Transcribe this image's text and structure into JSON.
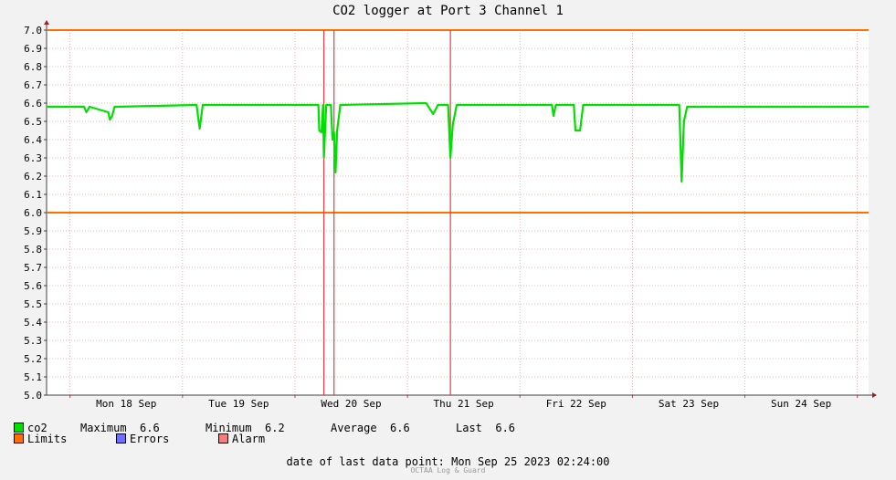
{
  "title": "CO2 logger at Port 3 Channel 1",
  "legend": {
    "co2": {
      "label": "co2",
      "color": "#00e000"
    },
    "maximum": {
      "label": "Maximum",
      "value": "6.6"
    },
    "minimum": {
      "label": "Minimum",
      "value": "6.2"
    },
    "average": {
      "label": "Average",
      "value": "6.6"
    },
    "last": {
      "label": "Last",
      "value": "6.6"
    },
    "limits": {
      "label": "Limits",
      "color": "#ff7000"
    },
    "errors": {
      "label": "Errors",
      "color": "#7070ff"
    },
    "alarm": {
      "label": "Alarm",
      "color": "#f08080"
    }
  },
  "footer": {
    "label": "date of last data point:",
    "value": "Mon Sep 25 2023 02:24:00"
  },
  "credit": "OCTAA Log & Guard",
  "chart_data": {
    "type": "line",
    "title": "CO2 logger at Port 3 Channel 1",
    "xlabel": "",
    "ylabel": "",
    "x_range": [
      "2023-09-17T19:00",
      "2023-09-25T02:24"
    ],
    "ylim": [
      5.0,
      7.0
    ],
    "yticks": [
      7.0,
      6.9,
      6.8,
      6.7,
      6.6,
      6.5,
      6.4,
      6.3,
      6.2,
      6.1,
      6.0,
      5.9,
      5.8,
      5.7,
      5.6,
      5.5,
      5.4,
      5.3,
      5.2,
      5.1,
      5.0
    ],
    "ytick_labels": [
      "7.0",
      "6.9",
      "6.8",
      "6.7",
      "6.6",
      "6.5",
      "6.4",
      "6.3",
      "6.2",
      "6.1",
      "6.0",
      "5.9",
      "5.8",
      "5.7",
      "5.6",
      "5.5",
      "5.4",
      "5.3",
      "5.2",
      "5.1",
      "5.0"
    ],
    "xticks": [
      {
        "label": "Mon 18 Sep",
        "date": "2023-09-18T12:00"
      },
      {
        "label": "Tue 19 Sep",
        "date": "2023-09-19T12:00"
      },
      {
        "label": "Wed 20 Sep",
        "date": "2023-09-20T12:00"
      },
      {
        "label": "Thu 21 Sep",
        "date": "2023-09-21T12:00"
      },
      {
        "label": "Fri 22 Sep",
        "date": "2023-09-22T12:00"
      },
      {
        "label": "Sat 23 Sep",
        "date": "2023-09-23T12:00"
      },
      {
        "label": "Sun 24 Sep",
        "date": "2023-09-24T12:00"
      }
    ],
    "day_boundaries": [
      "2023-09-18T00:00",
      "2023-09-19T00:00",
      "2023-09-20T00:00",
      "2023-09-21T00:00",
      "2023-09-22T00:00",
      "2023-09-23T00:00",
      "2023-09-24T00:00",
      "2023-09-25T00:00"
    ],
    "grid": true,
    "limits": [
      7.0,
      6.0
    ],
    "alarms": [
      "2023-09-20T06:10",
      "2023-09-20T08:20",
      "2023-09-21T09:10"
    ],
    "series": [
      {
        "name": "co2",
        "color": "#00e000",
        "points": [
          [
            "2023-09-17T19:00",
            6.58
          ],
          [
            "2023-09-18T03:00",
            6.58
          ],
          [
            "2023-09-18T03:30",
            6.55
          ],
          [
            "2023-09-18T04:10",
            6.58
          ],
          [
            "2023-09-18T08:10",
            6.55
          ],
          [
            "2023-09-18T08:30",
            6.51
          ],
          [
            "2023-09-18T09:00",
            6.53
          ],
          [
            "2023-09-18T09:30",
            6.58
          ],
          [
            "2023-09-19T03:00",
            6.59
          ],
          [
            "2023-09-19T03:40",
            6.46
          ],
          [
            "2023-09-19T04:20",
            6.59
          ],
          [
            "2023-09-20T05:00",
            6.59
          ],
          [
            "2023-09-20T05:10",
            6.45
          ],
          [
            "2023-09-20T05:40",
            6.44
          ],
          [
            "2023-09-20T06:00",
            6.59
          ],
          [
            "2023-09-20T06:10",
            6.3
          ],
          [
            "2023-09-20T06:40",
            6.59
          ],
          [
            "2023-09-20T07:40",
            6.59
          ],
          [
            "2023-09-20T08:00",
            6.4
          ],
          [
            "2023-09-20T08:20",
            6.44
          ],
          [
            "2023-09-20T08:40",
            6.22
          ],
          [
            "2023-09-20T09:00",
            6.45
          ],
          [
            "2023-09-20T09:40",
            6.59
          ],
          [
            "2023-09-21T04:00",
            6.6
          ],
          [
            "2023-09-21T05:30",
            6.54
          ],
          [
            "2023-09-21T06:30",
            6.59
          ],
          [
            "2023-09-21T08:40",
            6.59
          ],
          [
            "2023-09-21T09:10",
            6.3
          ],
          [
            "2023-09-21T09:40",
            6.48
          ],
          [
            "2023-09-21T10:30",
            6.59
          ],
          [
            "2023-09-22T06:50",
            6.59
          ],
          [
            "2023-09-22T07:10",
            6.53
          ],
          [
            "2023-09-22T07:40",
            6.59
          ],
          [
            "2023-09-22T11:30",
            6.59
          ],
          [
            "2023-09-22T11:50",
            6.45
          ],
          [
            "2023-09-22T12:50",
            6.45
          ],
          [
            "2023-09-22T13:30",
            6.59
          ],
          [
            "2023-09-23T10:00",
            6.59
          ],
          [
            "2023-09-23T10:30",
            6.17
          ],
          [
            "2023-09-23T11:00",
            6.5
          ],
          [
            "2023-09-23T11:40",
            6.58
          ],
          [
            "2023-09-25T02:24",
            6.58
          ]
        ]
      }
    ]
  }
}
